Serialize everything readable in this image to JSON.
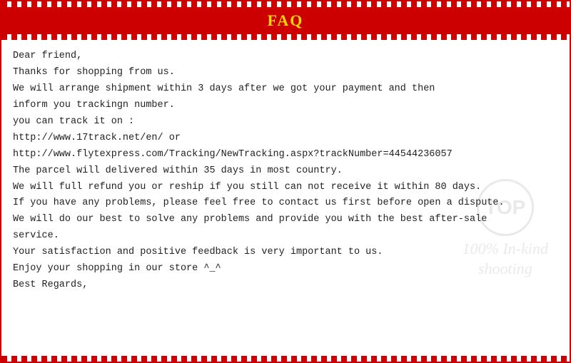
{
  "header": {
    "title": "FAQ"
  },
  "content": {
    "lines": [
      {
        "id": "line1",
        "text": "Dear friend,"
      },
      {
        "id": "line2",
        "text": "Thanks for shopping from us."
      },
      {
        "id": "line3",
        "text": "We will arrange shipment within 3 days after we got your payment and then"
      },
      {
        "id": "line4",
        "text": "inform you trackingn number."
      },
      {
        "id": "line5",
        "text": "you can track it on :"
      },
      {
        "id": "line6",
        "text": "http://www.17track.net/en/                          or"
      },
      {
        "id": "line7",
        "text": "http://www.flytexpress.com/Tracking/NewTracking.aspx?trackNumber=44544236057"
      },
      {
        "id": "line8",
        "text": "The parcel will delivered within 35 days in most country."
      },
      {
        "id": "line9",
        "text": "We will full refund you or reship if you still can not receive it within 80 days."
      },
      {
        "id": "line10",
        "text": "If you have any problems, please feel free to contact us first before open a dispute."
      },
      {
        "id": "line11",
        "text": "We will do our best to solve any problems and provide you with the best after-sale"
      },
      {
        "id": "line12",
        "text": "service."
      },
      {
        "id": "line13",
        "text": "Your satisfaction and positive feedback is very important to us."
      },
      {
        "id": "line14",
        "text": "Enjoy your shopping in our store ^_^"
      },
      {
        "id": "line15",
        "text": "Best Regards,"
      }
    ]
  },
  "watermark": {
    "circle_text": "TOP",
    "text_line1": "100% In-kind",
    "text_line2": "shooting"
  }
}
